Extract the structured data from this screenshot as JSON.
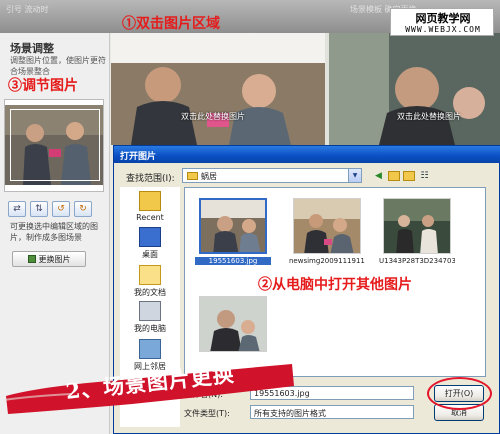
{
  "topbar": {
    "left_text": "引号  流动时",
    "right_text": "场景模板 确定更换"
  },
  "watermark": {
    "title": "网页教学网",
    "url": "WWW.WEBJX.COM"
  },
  "left_panel": {
    "title": "场景调整",
    "desc": "调整图片位置，使图片更符合场景整合",
    "step3_label": "③调节图片",
    "desc2": "可更换选中编辑区域的图片，制作成多图场景",
    "change_button": "更换图片"
  },
  "scene": {
    "step1_label": "①双击图片区域",
    "caption_left": "双击此处替换图片",
    "caption_right": "双击此处替换图片"
  },
  "dialog": {
    "title": "打开图片",
    "lookin_label": "查找范围(I):",
    "lookin_value": "蜗居",
    "places": [
      "Recent",
      "桌面",
      "我的文档",
      "我的电脑",
      "网上邻居"
    ],
    "files": [
      {
        "name": "19551603.jpg",
        "selected": true
      },
      {
        "name": "newsimg2009111911...",
        "selected": false
      },
      {
        "name": "U1343P28T3D234703...",
        "selected": false
      },
      {
        "name": "",
        "selected": false
      }
    ],
    "step2_label": "②从电脑中打开其他图片",
    "filename_label": "文件名(N):",
    "filename_value": "19551603.jpg",
    "filetype_label": "文件类型(T):",
    "filetype_value": "所有支持的图片格式",
    "open_button": "打开(O)",
    "cancel_button": "取消"
  },
  "banner": {
    "text": "2、场景图片更换",
    "color": "#d0122a"
  }
}
